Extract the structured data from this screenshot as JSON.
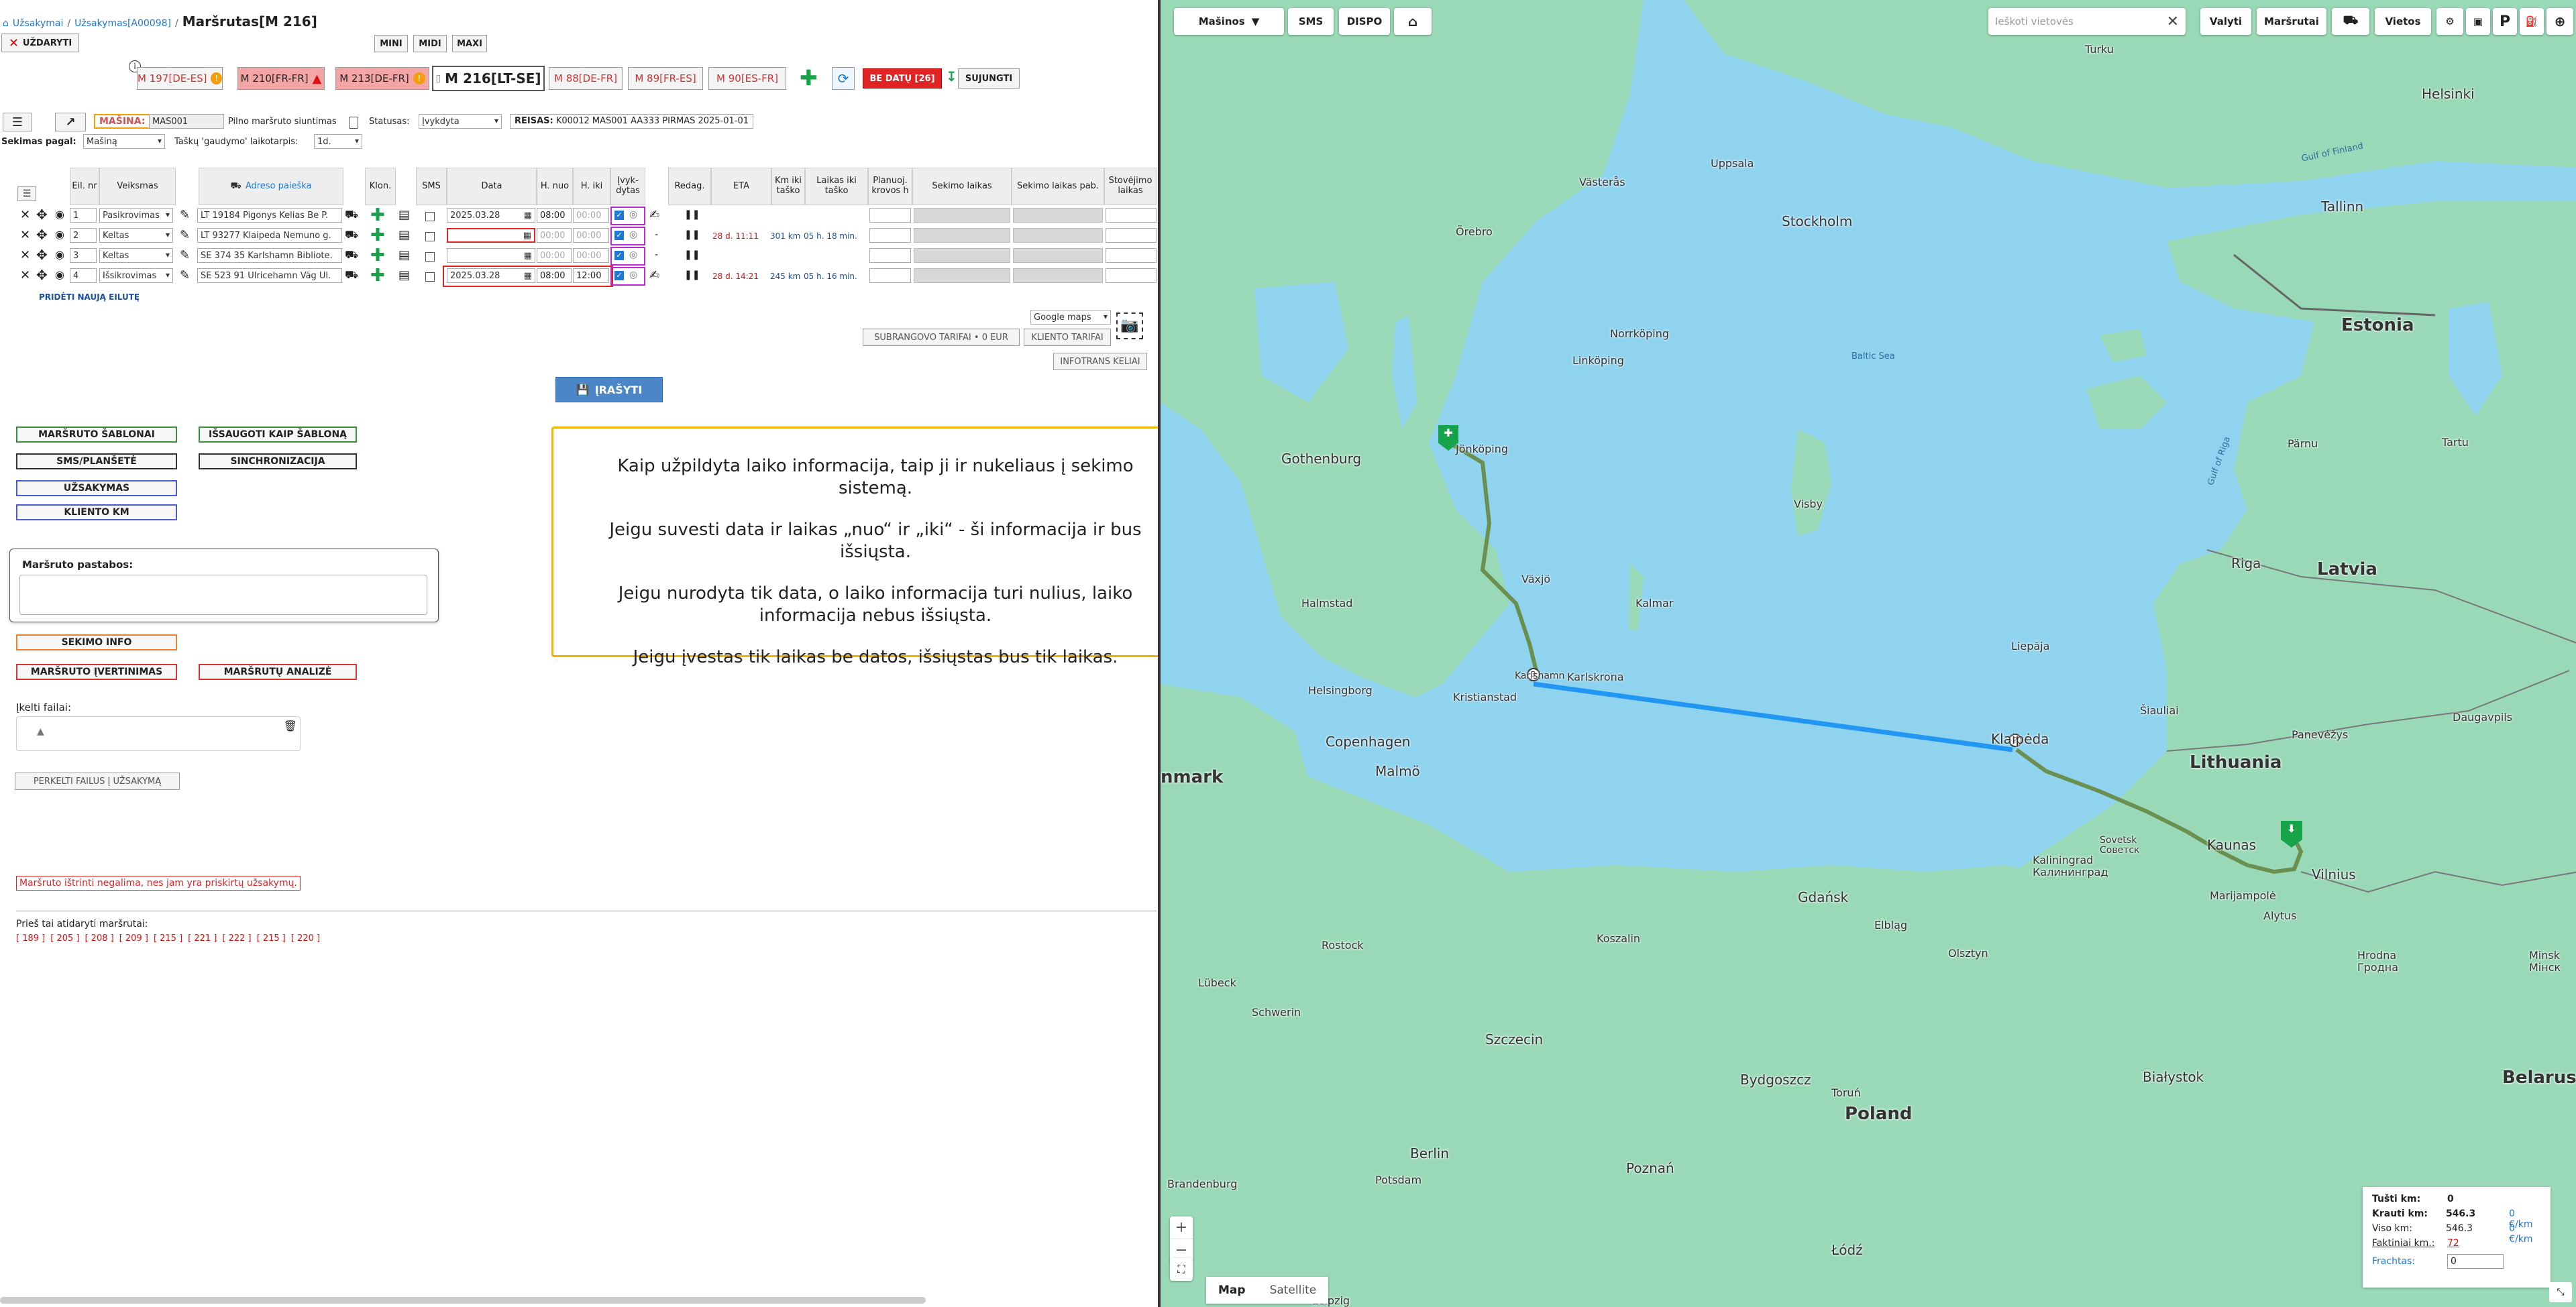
{
  "breadcrumb": {
    "orders": "Užsakymai",
    "order": "Užsakymas[A00098]",
    "sep": "/",
    "current": "Maršrutas[M 216]"
  },
  "toolbar": {
    "close": "UŽDARYTI",
    "mini": "MINI",
    "midi": "MIDI",
    "maxi": "MAXI"
  },
  "routes": [
    {
      "label": "M 197[DE-ES]",
      "warn": "!"
    },
    {
      "label": "M 210[FR-FR]",
      "warn": "!"
    },
    {
      "label": "M 213[DE-FR]",
      "warn": "!"
    },
    {
      "label": "M 216[LT-SE]",
      "warn": ""
    },
    {
      "label": "M 88[DE-FR]",
      "warn": ""
    },
    {
      "label": "M 89[FR-ES]",
      "warn": ""
    },
    {
      "label": "M 90[ES-FR]",
      "warn": ""
    }
  ],
  "route_actions": {
    "no_dates": "BE DATŲ [26]",
    "merge": "SUJUNGTI"
  },
  "vehicle": {
    "label": "MAŠINA:",
    "value": "MAS001",
    "send_full": "Pilno maršruto siuntimas",
    "status_label": "Statusas:",
    "status_value": "Įvykdyta",
    "trip_label": "REISAS:",
    "trip_value": "K00012 MAS001 AA333 PIRMAS 2025-01-01",
    "tracking_label": "Sekimas pagal:",
    "tracking_value": "Mašiną",
    "catch_label": "Taškų 'gaudymo' laikotarpis:",
    "catch_value": "1d."
  },
  "table": {
    "headers": {
      "nr": "Eil. nr",
      "action": "Veiksmas",
      "address": "Adreso paieška",
      "clone": "Klon.",
      "sms": "SMS",
      "date": "Data",
      "from": "H. nuo",
      "to": "H. iki",
      "done": "Įvyk-dytas",
      "edit": "Redag.",
      "eta": "ETA",
      "km": "Km iki taško",
      "time": "Laikas iki taško",
      "plan": "Planuoj. krovos h",
      "track_time": "Sekimo laikas",
      "track_time2": "Sekimo laikas pab.",
      "stop": "Stovėjimo laikas"
    },
    "rows": [
      {
        "nr": "1",
        "action": "Pasikrovimas",
        "address": "LT 19184 Pigonys Kelias Be P.",
        "date": "2025.03.28",
        "from": "08:00",
        "to": "00:00",
        "eta": "",
        "km": "",
        "time": ""
      },
      {
        "nr": "2",
        "action": "Keltas",
        "address": "LT 93277 Klaipeda Nemuno g.",
        "date": "",
        "from": "00:00",
        "to": "00:00",
        "eta": "28 d. 11:11",
        "km": "301 km",
        "time": "05 h. 18 min."
      },
      {
        "nr": "3",
        "action": "Keltas",
        "address": "SE 374 35 Karlshamn Bibliote.",
        "date": "",
        "from": "00:00",
        "to": "00:00",
        "eta": "",
        "km": "",
        "time": ""
      },
      {
        "nr": "4",
        "action": "Išsikrovimas",
        "address": "SE 523 91 Ulricehamn Väg Ul.",
        "date": "2025.03.28",
        "from": "08:00",
        "to": "12:00",
        "eta": "28 d. 14:21",
        "km": "245 km",
        "time": "05 h. 16 min."
      }
    ],
    "add_row": "PRIDĖTI NAUJĄ EILUTĘ"
  },
  "tariffs": {
    "maps": "Google maps",
    "subcontract": "SUBRANGOVO TARIFAI • 0 EUR",
    "client": "KLIENTO TARIFAI",
    "infotrans": "INFOTRANS KELIAI"
  },
  "save": "ĮRAŠYTI",
  "sidebar": {
    "templates": "MARŠRUTO ŠABLONAI",
    "save_template": "IŠSAUGOTI KAIP ŠABLONĄ",
    "sms": "SMS/PLANŠETĖ",
    "sync": "SINCHRONIZACIJA",
    "orders": "UŽSAKYMAS",
    "client_km": "KLIENTO KM",
    "notes_label": "Maršruto pastabos:",
    "tracking_info": "SEKIMO INFO",
    "rating": "MARŠRUTO ĮVERTINIMAS",
    "analysis": "MARŠRUTŲ ANALIZĖ",
    "upload_label": "Įkelti failai:",
    "move_files": "PERKELTI FAILUS Į UŽSAKYMĄ",
    "delete_error": "Maršruto ištrinti negalima, nes jam yra priskirtų užsakymų.",
    "prev_label": "Prieš tai atidaryti maršrutai:",
    "prev_routes": [
      "[ 189 ]",
      "[ 205 ]",
      "[ 208 ]",
      "[ 209 ]",
      "[ 215 ]",
      "[ 221 ]",
      "[ 222 ]",
      "[ 215 ]",
      "[ 220 ]"
    ]
  },
  "info_box": {
    "p1": "Kaip užpildyta laiko informacija, taip ji ir nukeliaus į sekimo sistemą.",
    "p2": "Jeigu suvesti data ir laikas „nuo“ ir „iki“ - ši informacija ir bus išsiųsta.",
    "p3": "Jeigu nurodyta tik data, o laiko informacija turi nulius, laiko informacija nebus išsiųsta.",
    "p4": "Jeigu įvestas tik laikas be datos, išsiųstas bus tik laikas."
  },
  "map": {
    "toolbar": {
      "vehicles": "Mašinos",
      "sms": "SMS",
      "dispo": "DISPO",
      "search_placeholder": "Ieškoti vietovės",
      "clear": "Valyti",
      "routes": "Maršrutai",
      "places": "Vietos",
      "parking": "P"
    },
    "labels": {
      "estonia": "Estonia",
      "latvia": "Latvia",
      "lithuania": "Lithuania",
      "poland": "Poland",
      "belarus": "Belarus",
      "denmark": "nmark",
      "stockholm": "Stockholm",
      "helsinki": "Helsinki",
      "tallinn": "Tallinn",
      "riga": "Riga",
      "vilnius": "Vilnius",
      "kaunas": "Kaunas",
      "klaipeda": "Klaipėda",
      "gothenburg": "Gothenburg",
      "jonkoping": "Jönköping",
      "copenhagen": "Copenhagen",
      "malmo": "Malmö",
      "gdansk": "Gdańsk",
      "szczecin": "Szczecin",
      "berlin": "Berlin",
      "bydgoszcz": "Bydgoszcz",
      "bialystok": "Białystok",
      "poznan": "Poznań",
      "lodz": "Łódź",
      "uppsala": "Uppsala",
      "orebro": "Örebro",
      "vasteras": "Västerås",
      "norrkoping": "Norrköping",
      "linkoping": "Linköping",
      "vaxjo": "Växjö",
      "karlskrona": "Karlskrona",
      "helsingborg": "Helsingborg",
      "visby": "Visby",
      "turku": "Turku",
      "tartu": "Tartu",
      "parnu": "Pärnu",
      "liepaja": "Liepāja",
      "daugavpils": "Daugavpils",
      "siauliai": "Šiauliai",
      "panevezys": "Panevėžys",
      "kaliningrad": "Kaliningrad\nКалининград",
      "minsk": "Minsk\nМінск",
      "olsztyn": "Olsztyn",
      "koszalin": "Koszalin",
      "rostock": "Rostock",
      "lubeck": "Lübeck",
      "schwerin": "Schwerin",
      "kalmar": "Kalmar",
      "halmstad": "Halmstad",
      "baltic_sea": "Baltic Sea",
      "gulf_finland": "Gulf of Finland",
      "gulf_riga": "Gulf of Riga",
      "hrodna": "Hrodna\nГродна",
      "kristianstad": "Kristianstad",
      "karlshamn": "Karlshamn",
      "leipzig": "Leipzig",
      "brandenburg": "Brandenburg",
      "potsdam": "Potsdam",
      "torun": "Toruń",
      "elblag": "Elbląg",
      "marijampole": "Marijampolė",
      "alytus": "Alytus",
      "sovetsk": "Sovetsk\nСоветск"
    },
    "map_type": {
      "map": "Map",
      "satellite": "Satellite"
    },
    "stats": {
      "empty_label": "Tušti km:",
      "empty": "0",
      "loaded_label": "Krauti km:",
      "loaded": "546.3",
      "loaded_rate": "0 €/km",
      "total_label": "Viso km:",
      "total": "546.3",
      "total_rate": "0 €/km",
      "actual_label": "Faktiniai km.:",
      "actual": "72",
      "freight_label": "Frachtas:",
      "freight": "0"
    }
  },
  "colors": {
    "accent": "#1e78d6",
    "route_road": "#6b8f4e",
    "route_ferry": "#2196f3",
    "error": "#d11",
    "land": "#9ad9b8",
    "water": "#8fd3ee"
  }
}
